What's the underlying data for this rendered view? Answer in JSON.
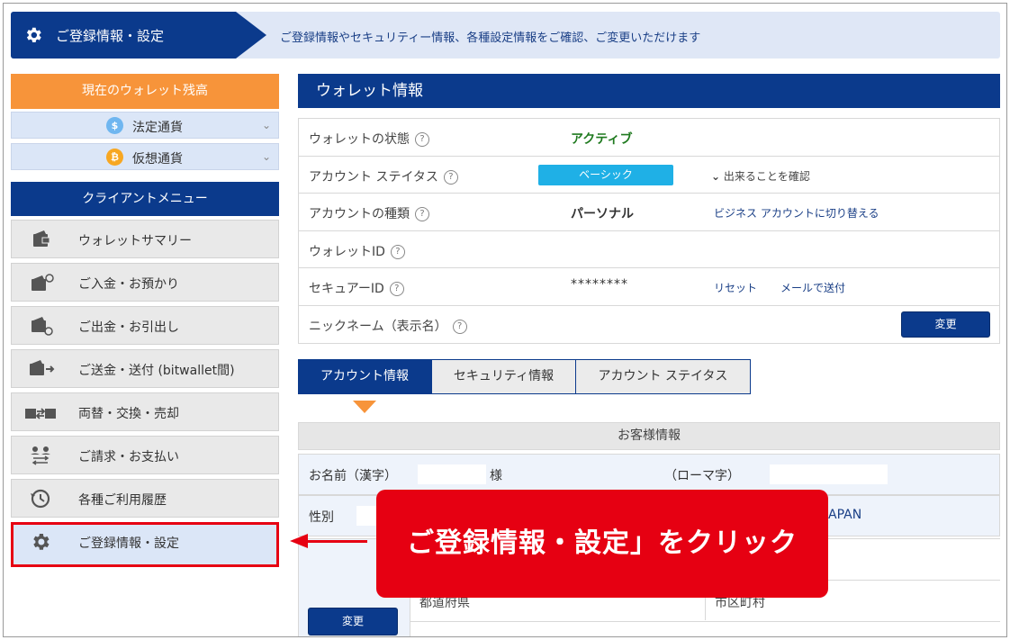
{
  "header": {
    "title": "ご登録情報・設定",
    "description": "ご登録情報やセキュリティー情報、各種設定情報をご確認、ご変更いただけます"
  },
  "sidebar": {
    "balance_title": "現在のウォレット残高",
    "currencies": [
      {
        "label": "法定通貨",
        "symbol": "$",
        "color": "#6fb6f0"
      },
      {
        "label": "仮想通貨",
        "symbol": "₿",
        "color": "#f7a722"
      }
    ],
    "menu_title": "クライアントメニュー",
    "menu": [
      {
        "label": "ウォレットサマリー",
        "icon": "wallet-icon"
      },
      {
        "label": "ご入金・お預かり",
        "icon": "wallet-deposit-icon"
      },
      {
        "label": "ご出金・お引出し",
        "icon": "wallet-withdraw-icon"
      },
      {
        "label": "ご送金・送付 (bitwallet間)",
        "icon": "wallet-send-icon"
      },
      {
        "label": "両替・交換・売却",
        "icon": "exchange-icon"
      },
      {
        "label": "ご請求・お支払い",
        "icon": "users-transfer-icon"
      },
      {
        "label": "各種ご利用履歴",
        "icon": "history-icon"
      },
      {
        "label": "ご登録情報・設定",
        "icon": "gear-icon"
      }
    ]
  },
  "wallet": {
    "title": "ウォレット情報",
    "rows": {
      "status": {
        "label": "ウォレットの状態",
        "value": "アクティブ"
      },
      "account_status": {
        "label": "アカウント ステイタス",
        "badge": "ベーシック",
        "link": "出来ることを確認"
      },
      "account_type": {
        "label": "アカウントの種類",
        "value": "パーソナル",
        "link": "ビジネス アカウントに切り替える"
      },
      "wallet_id": {
        "label": "ウォレットID"
      },
      "secure_id": {
        "label": "セキュアーID",
        "value": "********",
        "reset": "リセット",
        "mail": "メールで送付"
      },
      "nickname": {
        "label": "ニックネーム（表示名）",
        "button": "変更"
      }
    }
  },
  "tabs": [
    "アカウント情報",
    "セキュリティ情報",
    "アカウント ステイタス"
  ],
  "customer": {
    "title": "お客様情報",
    "name_kanji_label": "お名前（漢字）",
    "honorific": "様",
    "name_roman_label": "（ローマ字）",
    "gender_label": "性別",
    "country_partial": "APAN",
    "prefecture_label": "都道府県",
    "city_label": "市区町村",
    "change_button": "変更"
  },
  "callout": {
    "text": "ご登録情報・設定」をクリック"
  }
}
